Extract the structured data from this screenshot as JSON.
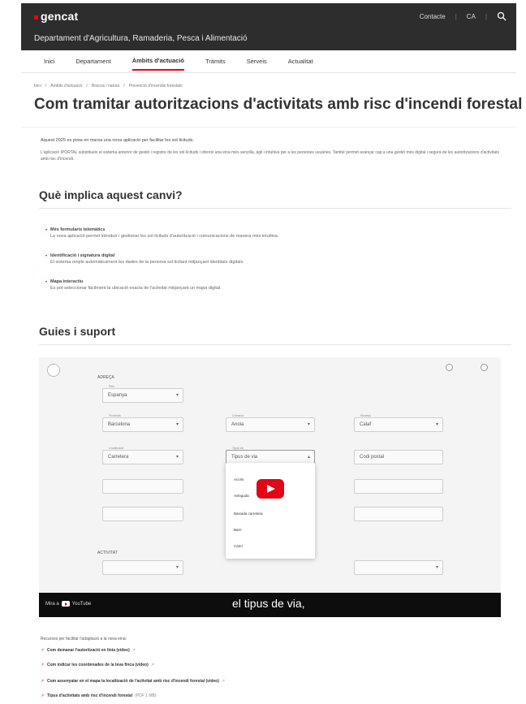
{
  "header": {
    "logo": "gencat",
    "links": [
      "Contacte",
      "CA"
    ],
    "department": "Departament d'Agricultura, Ramaderia, Pesca i Alimentació"
  },
  "nav": {
    "items": [
      "Inici",
      "Departament",
      "Àmbits d'actuació",
      "Tràmits",
      "Serveis",
      "Actualitat"
    ],
    "active_index": 2
  },
  "breadcrumb": [
    "Inici",
    "Àmbits d'actuació",
    "Boscos i natura",
    "Prevenció d'incendis forestals"
  ],
  "page_title": "Com tramitar autoritzacions d'activitats amb risc d'incendi forestal",
  "intro": {
    "line1": "Aquest 2025 es posa en marxa una nova aplicació per facilitar les sol·licituds.",
    "line2": "L'aplicació IPORTAL substitueix el sistema anterior de gestió i registre de les sol·licituds i ofereix una eina més senzilla, àgil i intuïtiva per a les persones usuàries. També permet avançar cap a una gestió més digital i segura de les autoritzacions d'activitats amb risc d'incendi."
  },
  "section1": {
    "heading": "Què implica aquest canvi?",
    "bullets": [
      {
        "title": "Més formularis telemàtics",
        "desc": "La nova aplicació permet introduir i gestionar les sol·licituds d'autorització i comunicacions de manera més intuïtiva."
      },
      {
        "title": "Identificació i signatura digital",
        "desc": "El sistema omple automàticament les dades de la persona sol·licitant mitjançant identitats digitals."
      },
      {
        "title": "Mapa interactiu",
        "desc": "Es pot seleccionar fàcilment la ubicació exacta de l'activitat mitjançant un mapa digital."
      }
    ]
  },
  "section2": {
    "heading": "Guies i suport"
  },
  "video": {
    "section_label_1": "ADREÇA",
    "section_label_2": "ACTIVITAT",
    "fields": [
      "Espanya",
      "Barcelona",
      "Anoia",
      "Calaf",
      "Carretera",
      "Tipus de via",
      "Codi postal"
    ],
    "dropdown_options": [
      "Accés",
      "Avinguda",
      "Baixada carretera",
      "Barri",
      "Camí"
    ],
    "watch_on": "Mira a",
    "youtube_label": "YouTube",
    "subtitle": "el tipus de via,"
  },
  "resources": {
    "heading": "Recursos per facilitar l'adaptació a la nova eina:",
    "items": [
      {
        "label": "Com demanar l'autorització en línia (vídeo)",
        "ext": "↗"
      },
      {
        "label": "Com indicar les coordenades de la teva finca (vídeo)",
        "ext": "↗"
      },
      {
        "label": "Com assenyalar en el mapa la localització de l'activitat amb risc d'incendi forestal (vídeo)",
        "ext": "↗"
      },
      {
        "label": "Tipus d'activitats amb risc d'incendi forestal",
        "ext": "(PDF 1 MB)"
      }
    ]
  },
  "colors": {
    "accent": "#e10714",
    "header_bg": "#2d2d2d"
  }
}
